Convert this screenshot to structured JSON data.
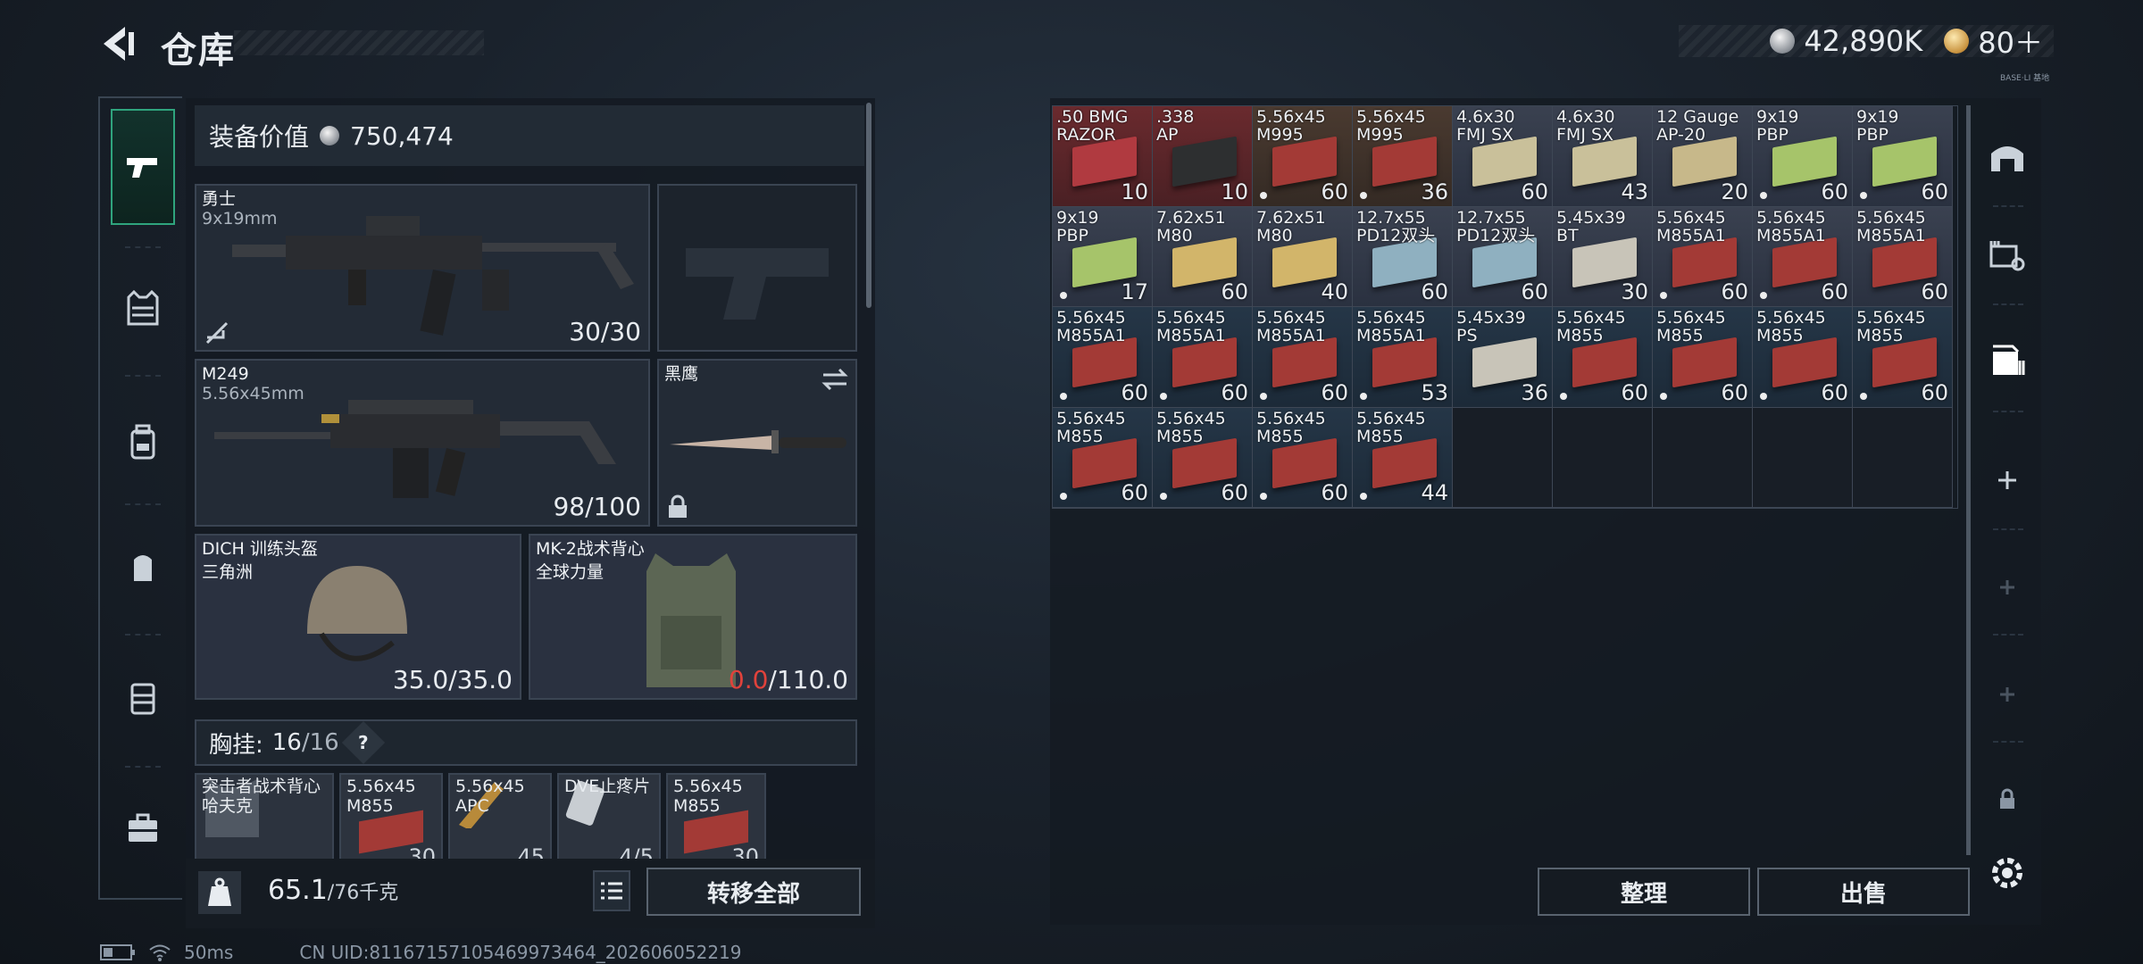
{
  "header": {
    "title": "仓库",
    "silver": "42,890K",
    "gold": "80＋",
    "tag": "BASE·LI 基地"
  },
  "equip_value": {
    "label": "装备价值",
    "value": "750,474"
  },
  "primary": {
    "name": "勇士",
    "caliber": "9x19mm",
    "ammo": "30/30"
  },
  "secondary": {
    "name": "M249",
    "caliber": "5.56x45mm",
    "ammo": "98/100"
  },
  "melee": {
    "name": "黑鹰"
  },
  "helmet": {
    "name": "DICH 训练头盔",
    "sub": "三角洲",
    "cur": "35.0",
    "max": "/35.0"
  },
  "armor": {
    "name": "MK-2战术背心",
    "sub": "全球力量",
    "cur": "0.0",
    "max": "/110.0"
  },
  "chest": {
    "label": "胸挂:",
    "cur": "16",
    "max": "/16",
    "help": "?"
  },
  "rig": [
    {
      "name": "突击者战术背心",
      "sub": "哈夫克",
      "count": ""
    },
    {
      "name": "5.56x45",
      "sub": "M855",
      "count": "30"
    },
    {
      "name": "5.56x45",
      "sub": "APC",
      "count": "45"
    },
    {
      "name": "DVE止疼片",
      "sub": "",
      "count": "4/5"
    },
    {
      "name": "5.56x45",
      "sub": "M855",
      "count": "30"
    }
  ],
  "weight": {
    "cur": "65.1",
    "max": "/76千克"
  },
  "buttons": {
    "transfer": "转移全部",
    "sort": "整理",
    "sell": "出售"
  },
  "status": {
    "ping": "50ms",
    "uid": "CN UID:8116715710546997​3464_202606052219"
  },
  "storage": [
    {
      "n1": ".50 BMG",
      "n2": "RAZOR",
      "q": "10",
      "bg": "bg-red",
      "box": "#b03a40",
      "dot": false
    },
    {
      "n1": ".338",
      "n2": "AP",
      "q": "10",
      "bg": "bg-red",
      "box": "#2d2f30",
      "dot": false
    },
    {
      "n1": "5.56x45",
      "n2": "M995",
      "q": "60",
      "bg": "bg-brown",
      "box": "#a33a36",
      "dot": true
    },
    {
      "n1": "5.56x45",
      "n2": "M995",
      "q": "36",
      "bg": "bg-brown",
      "box": "#a33a36",
      "dot": true
    },
    {
      "n1": "4.6x30",
      "n2": "FMJ SX",
      "q": "60",
      "bg": "bg-tan",
      "box": "#c9c09a",
      "dot": false
    },
    {
      "n1": "4.6x30",
      "n2": "FMJ SX",
      "q": "43",
      "bg": "bg-tan",
      "box": "#c9c09a",
      "dot": false
    },
    {
      "n1": "12 Gauge",
      "n2": "AP-20",
      "q": "20",
      "bg": "bg-tan",
      "box": "#c7b88a",
      "dot": false
    },
    {
      "n1": "9x19",
      "n2": "PBP",
      "q": "60",
      "bg": "bg-tan",
      "box": "#a6c46a",
      "dot": true
    },
    {
      "n1": "9x19",
      "n2": "PBP",
      "q": "60",
      "bg": "bg-tan",
      "box": "#a6c46a",
      "dot": true
    },
    {
      "n1": "9x19",
      "n2": "PBP",
      "q": "17",
      "bg": "bg-tan",
      "box": "#a6c46a",
      "dot": true
    },
    {
      "n1": "7.62x51",
      "n2": "M80",
      "q": "60",
      "bg": "bg-tan",
      "box": "#d2b56a",
      "dot": false
    },
    {
      "n1": "7.62x51",
      "n2": "M80",
      "q": "40",
      "bg": "bg-tan",
      "box": "#d2b56a",
      "dot": false
    },
    {
      "n1": "12.7x55",
      "n2": "PD12双头",
      "q": "60",
      "bg": "bg-tan",
      "box": "#8fb0c0",
      "dot": false
    },
    {
      "n1": "12.7x55",
      "n2": "PD12双头",
      "q": "60",
      "bg": "bg-tan",
      "box": "#8fb0c0",
      "dot": false
    },
    {
      "n1": "5.45x39",
      "n2": "BT",
      "q": "30",
      "bg": "bg-tan",
      "box": "#c8c4b8",
      "dot": false
    },
    {
      "n1": "5.56x45",
      "n2": "M855A1",
      "q": "60",
      "bg": "bg-tan",
      "box": "#a33a36",
      "dot": true
    },
    {
      "n1": "5.56x45",
      "n2": "M855A1",
      "q": "60",
      "bg": "bg-tan",
      "box": "#a33a36",
      "dot": true
    },
    {
      "n1": "5.56x45",
      "n2": "M855A1",
      "q": "60",
      "bg": "bg-tan",
      "box": "#a33a36",
      "dot": false
    },
    {
      "n1": "5.56x45",
      "n2": "M855A1",
      "q": "60",
      "bg": "bg-blue",
      "box": "#a33a36",
      "dot": true
    },
    {
      "n1": "5.56x45",
      "n2": "M855A1",
      "q": "60",
      "bg": "bg-blue",
      "box": "#a33a36",
      "dot": true
    },
    {
      "n1": "5.56x45",
      "n2": "M855A1",
      "q": "60",
      "bg": "bg-blue",
      "box": "#a33a36",
      "dot": true
    },
    {
      "n1": "5.56x45",
      "n2": "M855A1",
      "q": "53",
      "bg": "bg-blue",
      "box": "#a33a36",
      "dot": true
    },
    {
      "n1": "5.45x39",
      "n2": "PS",
      "q": "36",
      "bg": "bg-blue",
      "box": "#c8c4b8",
      "dot": false
    },
    {
      "n1": "5.56x45",
      "n2": "M855",
      "q": "60",
      "bg": "bg-blue",
      "box": "#a33a36",
      "dot": true
    },
    {
      "n1": "5.56x45",
      "n2": "M855",
      "q": "60",
      "bg": "bg-blue",
      "box": "#a33a36",
      "dot": true
    },
    {
      "n1": "5.56x45",
      "n2": "M855",
      "q": "60",
      "bg": "bg-blue",
      "box": "#a33a36",
      "dot": true
    },
    {
      "n1": "5.56x45",
      "n2": "M855",
      "q": "60",
      "bg": "bg-blue",
      "box": "#a33a36",
      "dot": true
    },
    {
      "n1": "5.56x45",
      "n2": "M855",
      "q": "60",
      "bg": "bg-blue",
      "box": "#a33a36",
      "dot": true
    },
    {
      "n1": "5.56x45",
      "n2": "M855",
      "q": "60",
      "bg": "bg-blue",
      "box": "#a33a36",
      "dot": true
    },
    {
      "n1": "5.56x45",
      "n2": "M855",
      "q": "60",
      "bg": "bg-blue",
      "box": "#a33a36",
      "dot": true
    },
    {
      "n1": "5.56x45",
      "n2": "M855",
      "q": "44",
      "bg": "bg-blue",
      "box": "#a33a36",
      "dot": true
    }
  ],
  "storage_slots": 36,
  "colors": {
    "accent": "#2fa47d",
    "warn": "#e0423b"
  }
}
